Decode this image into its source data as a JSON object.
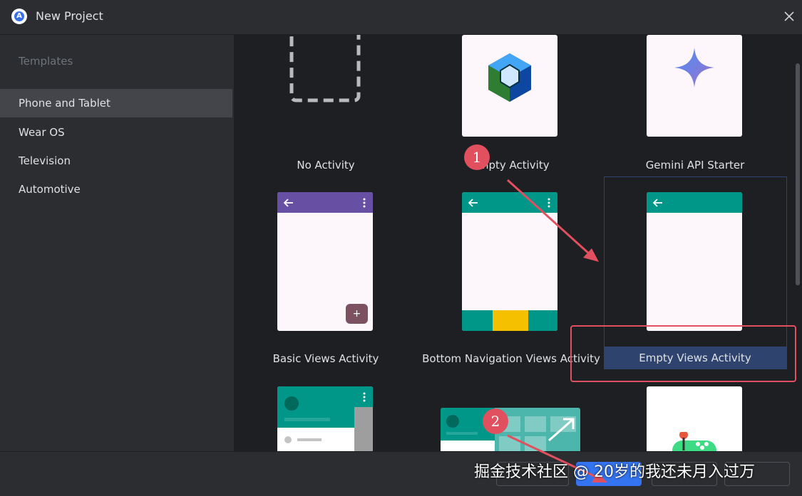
{
  "window": {
    "title": "New Project"
  },
  "sidebar": {
    "header": "Templates",
    "items": [
      {
        "label": "Phone and Tablet",
        "active": true
      },
      {
        "label": "Wear OS",
        "active": false
      },
      {
        "label": "Television",
        "active": false
      },
      {
        "label": "Automotive",
        "active": false
      }
    ]
  },
  "templates": [
    {
      "label": "No Activity"
    },
    {
      "label": "Empty Activity"
    },
    {
      "label": "Gemini API Starter"
    },
    {
      "label": "Basic Views Activity"
    },
    {
      "label": "Bottom Navigation Views Activity"
    },
    {
      "label": "Empty Views Activity",
      "selected": true
    }
  ],
  "annotations": {
    "marker1": "1",
    "marker2": "2"
  },
  "watermark": "掘金技术社区 @ 20岁的我还未月入过万",
  "colors": {
    "accent": "#3574f0",
    "selection": "#2e436e",
    "annotation": "#e0505f",
    "teal_appbar": "#009688",
    "purple_appbar": "#6750a4"
  }
}
